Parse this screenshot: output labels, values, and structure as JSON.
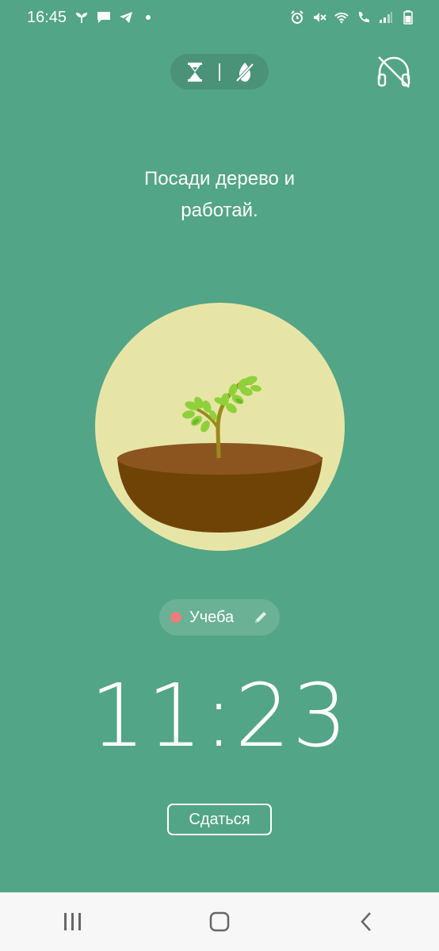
{
  "status_bar": {
    "time": "16:45",
    "left_icons": [
      "sprout-icon",
      "message-icon",
      "telegram-icon",
      "dot-icon"
    ],
    "right_icons": [
      "alarm-icon",
      "mute-icon",
      "wifi-icon",
      "call-icon",
      "signal-icon",
      "battery-icon"
    ]
  },
  "mode_toggle": {
    "icons": [
      "hourglass-icon",
      "timer-off-icon"
    ]
  },
  "prompt": {
    "line1": "Посади дерево и",
    "line2": "работай."
  },
  "tag": {
    "label": "Учеба",
    "dot_color": "#e8807a"
  },
  "timer": {
    "value": "11:23"
  },
  "give_up": {
    "label": "Сдаться"
  },
  "colors": {
    "background": "#52a586",
    "circle": "#e7e5a6",
    "soil_top": "#8b5520",
    "soil_bowl": "#6f4306",
    "leaf": "#8fd13b",
    "stem": "#9b8a1c"
  }
}
